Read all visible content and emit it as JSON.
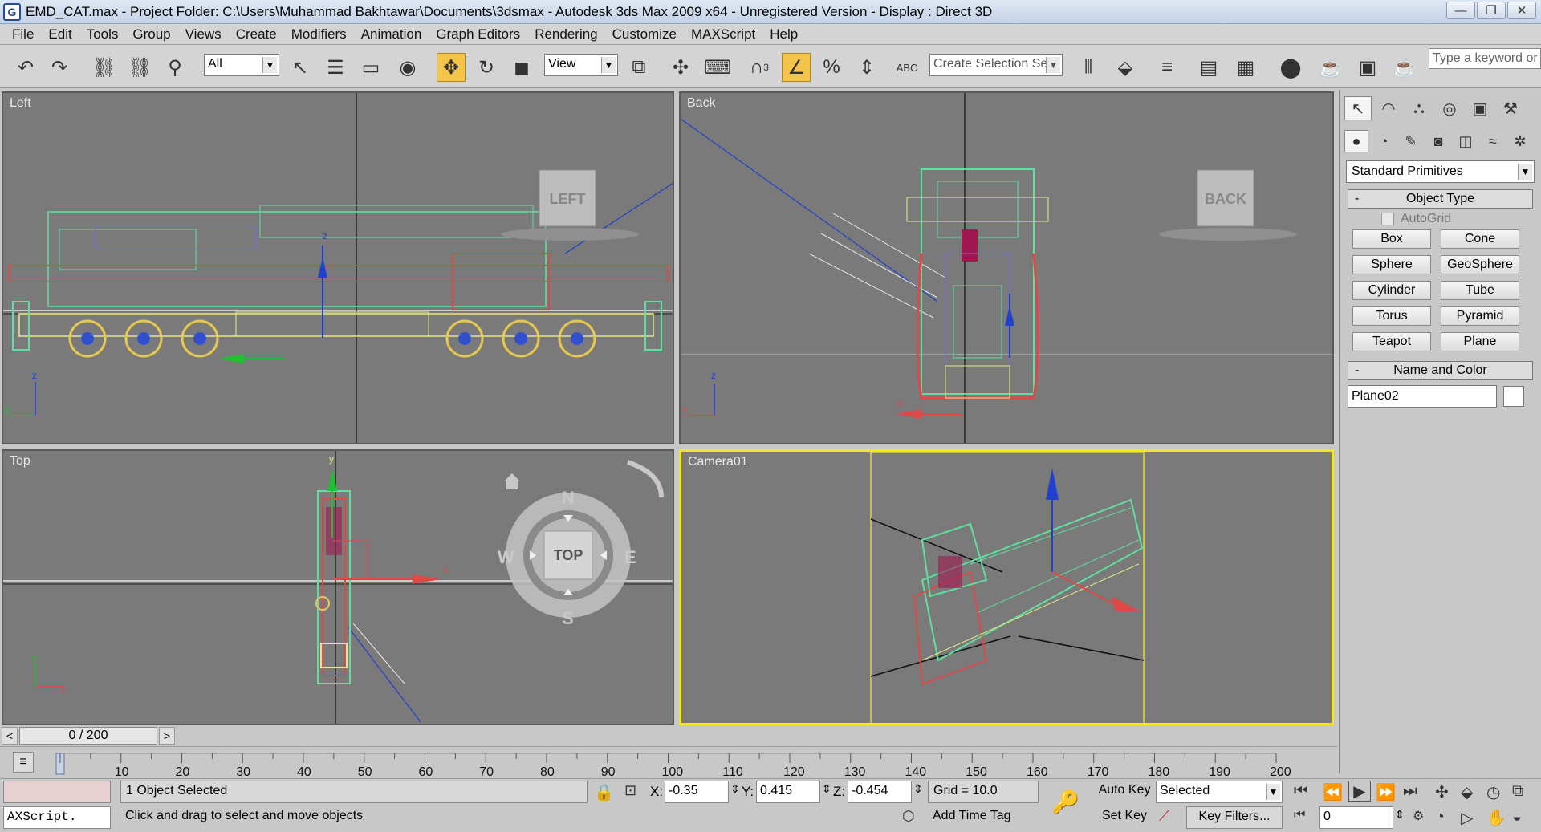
{
  "window": {
    "title": "EMD_CAT.max      - Project Folder: C:\\Users\\Muhammad Bakhtawar\\Documents\\3dsmax      - Autodesk 3ds Max  2009 x64   - Unregistered Version      - Display : Direct 3D",
    "app_icon": "G",
    "min_glyph": "—",
    "max_glyph": "❐",
    "close_glyph": "✕"
  },
  "menu": [
    "File",
    "Edit",
    "Tools",
    "Group",
    "Views",
    "Create",
    "Modifiers",
    "Animation",
    "Graph Editors",
    "Rendering",
    "Customize",
    "MAXScript",
    "Help"
  ],
  "toolbar": {
    "filter_value": "All",
    "reference_value": "View",
    "selection_set_placeholder": "Create Selection Set",
    "search_placeholder": "Type a keyword or",
    "snap_label": "3",
    "icons": {
      "undo": "↶",
      "redo": "↷",
      "link": "⛓",
      "unlink": "⛓",
      "bind": "⚲",
      "select": "↖",
      "select_by_name": "☰",
      "rect_region": "▭",
      "window_crossing": "◉",
      "move": "✥",
      "rotate": "↻",
      "scale": "◼",
      "mirror_pivot": "⧉",
      "manipulate": "✣",
      "keyboard": "⌨",
      "snap3": "∩",
      "angle_snap": "∠",
      "percent_snap": "%",
      "spinner_snap": "⇕",
      "named_sel": "ABC",
      "mirror": "⫴",
      "align": "⬙",
      "layers": "≡",
      "curve_editor": "▤",
      "schematic": "▦",
      "material": "⬤",
      "render_setup": "☕",
      "render_frame": "▣",
      "render": "☕"
    }
  },
  "viewports": {
    "left": {
      "label": "Left",
      "cube_label": "LEFT"
    },
    "back": {
      "label": "Back",
      "cube_label": "BACK"
    },
    "top": {
      "label": "Top",
      "compass": {
        "n": "N",
        "s": "S",
        "e": "E",
        "w": "W",
        "center": "TOP"
      }
    },
    "camera": {
      "label": "Camera01"
    },
    "axis": {
      "x": "x",
      "y": "y",
      "z": "z"
    }
  },
  "command_panel": {
    "tab_icons": [
      "↖",
      "◠",
      "⛬",
      "◎",
      "▣",
      "⚒"
    ],
    "subtab_icons": [
      "●",
      "◔",
      "✎",
      "◙",
      "◫",
      "≈",
      "✲"
    ],
    "category": "Standard Primitives",
    "object_type": {
      "title": "Object Type",
      "toggle": "-",
      "autogrid": "AutoGrid",
      "buttons": [
        "Box",
        "Cone",
        "Sphere",
        "GeoSphere",
        "Cylinder",
        "Tube",
        "Torus",
        "Pyramid",
        "Teapot",
        "Plane"
      ]
    },
    "name_color": {
      "title": "Name and Color",
      "toggle": "-",
      "name": "Plane02",
      "color": "#ffffff"
    }
  },
  "timeline": {
    "frame_display": "0 / 200",
    "left_arrow": "<",
    "right_arrow": ">",
    "ticks": [
      "10",
      "20",
      "30",
      "40",
      "50",
      "60",
      "70",
      "80",
      "90",
      "100",
      "110",
      "120",
      "130",
      "140",
      "150",
      "160",
      "170",
      "180",
      "190",
      "200"
    ]
  },
  "status": {
    "maxscript_label": "AXScript.",
    "selected_count": "1 Object Selected",
    "prompt": "Click and drag to select and move objects",
    "x_label": "X:",
    "x_value": "-0.35",
    "y_label": "Y:",
    "y_value": "0.415",
    "z_label": "Z:",
    "z_value": "-0.454",
    "grid": "Grid = 10.0",
    "add_time_tag": "Add Time Tag",
    "auto_key": "Auto Key",
    "set_key": "Set Key",
    "key_mode": "Selected",
    "key_filters": "Key Filters...",
    "current_frame": "0",
    "key_icon": "🔑",
    "playback": {
      "first": "⏮",
      "prev": "⏪",
      "play": "▶",
      "next": "⏩",
      "last": "⏭"
    },
    "nav_icons": [
      "✣",
      "⬙",
      "◷",
      "⧉",
      "◔",
      "▷",
      "✋",
      "◒",
      "⧉"
    ]
  }
}
